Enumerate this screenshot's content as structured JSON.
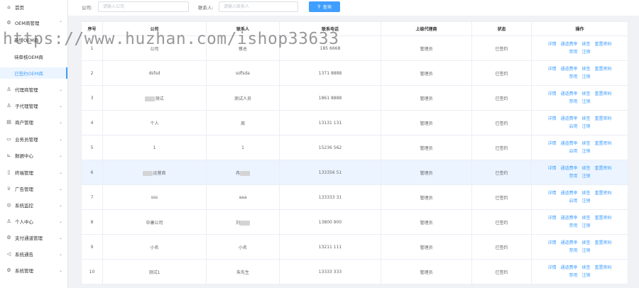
{
  "sidebar": {
    "home": "首页",
    "oem": "OEM商管理",
    "oem_sub": [
      "新增OEM商",
      "待审核OEM商",
      "已签约OEM商"
    ],
    "items": [
      {
        "label": "代理商管理",
        "icon": "user-icon"
      },
      {
        "label": "子代理管理",
        "icon": "users-icon"
      },
      {
        "label": "商户管理",
        "icon": "shop-icon"
      },
      {
        "label": "业务员管理",
        "icon": "id-card-icon"
      },
      {
        "label": "数据中心",
        "icon": "chart-icon"
      },
      {
        "label": "终端管理",
        "icon": "terminal-icon"
      },
      {
        "label": "广告管理",
        "icon": "trophy-icon"
      },
      {
        "label": "系统监控",
        "icon": "monitor-icon"
      },
      {
        "label": "个人中心",
        "icon": "person-icon"
      },
      {
        "label": "支付通道管理",
        "icon": "gear-icon"
      },
      {
        "label": "系统通告",
        "icon": "megaphone-icon"
      },
      {
        "label": "系统管理",
        "icon": "settings-icon"
      }
    ]
  },
  "search": {
    "company_label": "公司:",
    "company_placeholder": "请输入公司",
    "contact_label": "联系人:",
    "contact_placeholder": "请输入联系人",
    "query_label": "查询"
  },
  "table": {
    "headers": [
      "序号",
      "公司",
      "联系人",
      "联系电话",
      "上级代理商",
      "状态",
      "操作"
    ],
    "ops_line1": [
      "详情",
      "通道费率",
      "续签",
      "重置密码"
    ],
    "rows": [
      {
        "no": "1",
        "company": "公司",
        "contact": "蔡总",
        "phone": "185 6668",
        "parent": "管理员",
        "status": "已签约",
        "toggle": "禁用",
        "del": "注销"
      },
      {
        "no": "2",
        "company": "dsfsd",
        "contact": "sdfsda",
        "phone": "1371 8888",
        "parent": "管理员",
        "status": "已签约",
        "toggle": "禁用",
        "del": "注销"
      },
      {
        "no": "3",
        "company": "测试",
        "contact": "测试人员",
        "phone": "1861 8888",
        "parent": "管理员",
        "status": "已签约",
        "toggle": "禁用",
        "del": "注销"
      },
      {
        "no": "4",
        "company": "个人",
        "contact": "周",
        "phone": "13131 131",
        "parent": "管理员",
        "status": "已签约",
        "toggle": "启用",
        "del": "注销"
      },
      {
        "no": "5",
        "company": "1",
        "contact": "1",
        "phone": "15236 562",
        "parent": "管理员",
        "status": "已签约",
        "toggle": "启用",
        "del": "注销"
      },
      {
        "no": "6",
        "company": "运营商",
        "contact": "冉",
        "phone": "133356 51",
        "parent": "管理员",
        "status": "已签约",
        "toggle": "禁用",
        "del": "注销"
      },
      {
        "no": "7",
        "company": "sss",
        "contact": "aaa",
        "phone": "133333 31",
        "parent": "管理员",
        "status": "已签约",
        "toggle": "启用",
        "del": "注销"
      },
      {
        "no": "8",
        "company": "中康公司",
        "contact": "刘",
        "phone": "13800 900",
        "parent": "管理员",
        "status": "已签约",
        "toggle": "禁用",
        "del": "注销"
      },
      {
        "no": "9",
        "company": "小名",
        "contact": "小名",
        "phone": "13211 111",
        "parent": "管理员",
        "status": "已签约",
        "toggle": "禁用",
        "del": "注销"
      },
      {
        "no": "10",
        "company": "测试1",
        "contact": "朱先生",
        "phone": "13333 333",
        "parent": "管理员",
        "status": "已签约",
        "toggle": "禁用",
        "del": "注销"
      }
    ]
  },
  "watermark": "https://www.huzhan.com/ishop33633",
  "colors": {
    "accent": "#409eff",
    "highlight": "#ecf5ff"
  }
}
